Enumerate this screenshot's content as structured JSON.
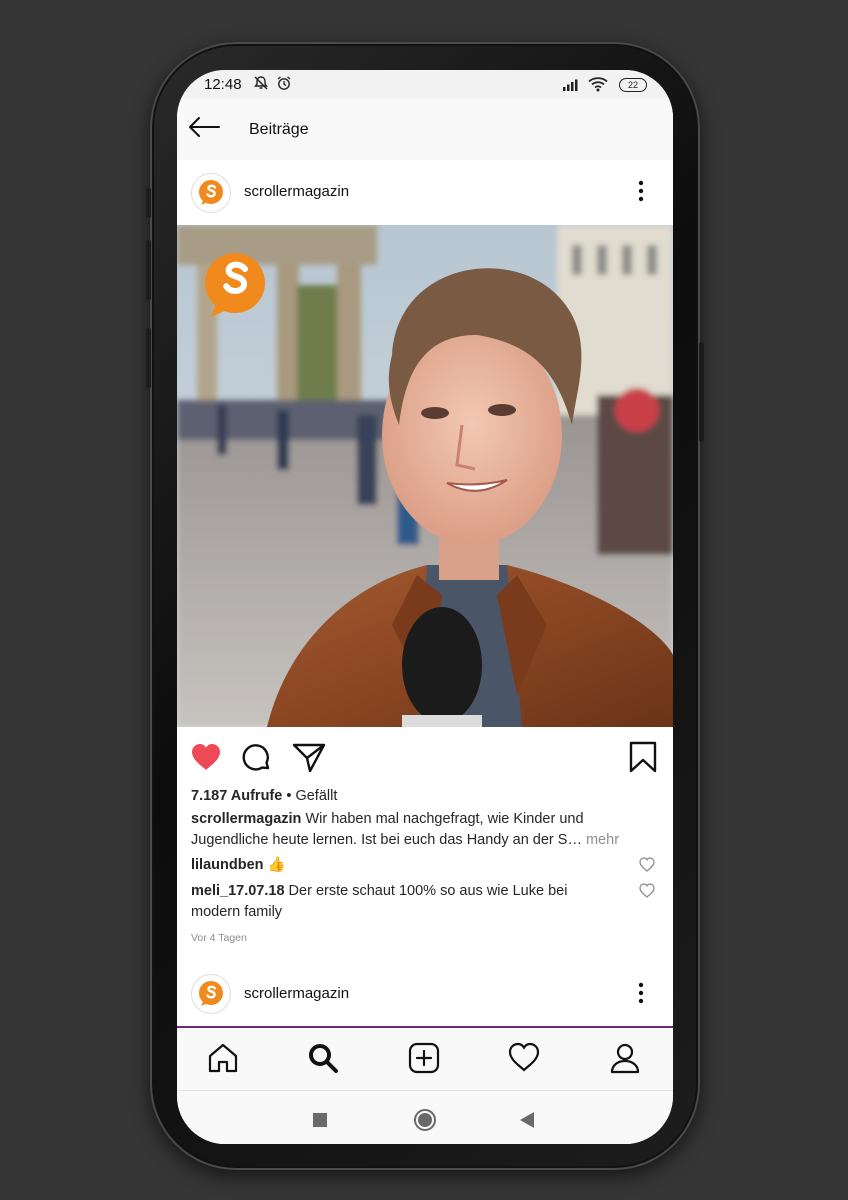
{
  "status_bar": {
    "time": "12:48",
    "battery": "22",
    "icons": [
      "bell-muted-icon",
      "alarm-icon",
      "signal-icon",
      "wifi-icon",
      "battery-icon"
    ]
  },
  "header": {
    "title": "Beiträge",
    "back_icon": "arrow-left-icon"
  },
  "post": {
    "username": "scrollermagazin",
    "views_count": "7.187 Aufrufe",
    "views_separator": " • ",
    "views_suffix": "Gefällt",
    "caption_user": "scrollermagazin",
    "caption_text": " Wir haben mal nachgefragt, wie Kinder und Jugendliche heute lernen. Ist bei euch das Handy an der S…",
    "caption_more": " mehr",
    "liked": true,
    "comments": [
      {
        "user": "lilaundben",
        "text": " 👍"
      },
      {
        "user": "meli_17.07.18",
        "text": " Der erste schaut 100% so aus wie Luke bei modern family"
      }
    ],
    "timestamp": "Vor 4 Tagen"
  },
  "next_post": {
    "username": "scrollermagazin"
  },
  "tab_bar": [
    "home-icon",
    "search-icon",
    "add-post-icon",
    "activity-heart-icon",
    "profile-icon"
  ],
  "colors": {
    "accent_like": "#ed4956",
    "brand_orange": "#f08a1c",
    "divider_purple": "#6b2a75"
  }
}
